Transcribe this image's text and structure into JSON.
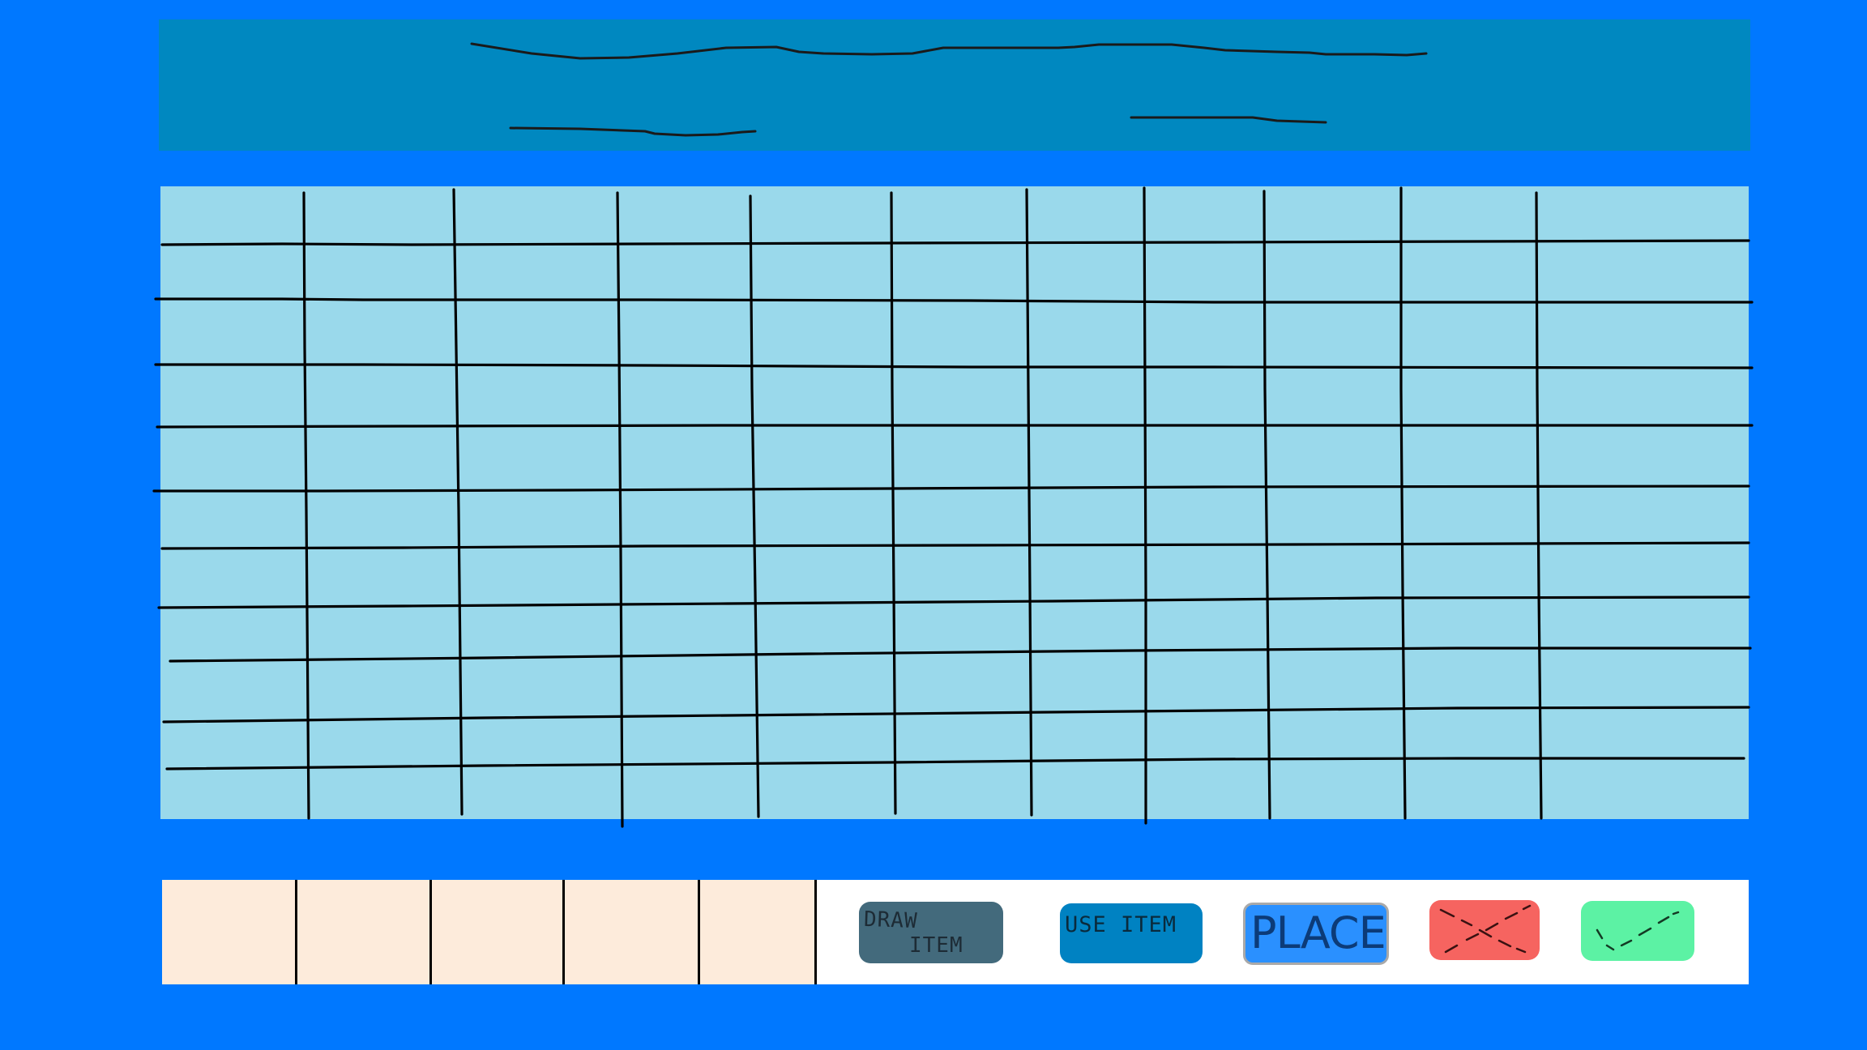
{
  "colors": {
    "background": "#0078ff",
    "header_bar": "#0088c0",
    "board": "#9ad9eb",
    "grid_line": "#000000",
    "sketch_line": "#1a1a1a",
    "bottom_bar": "#ffffff",
    "hand_slot": "#fdebdb",
    "draw_button": "#436a7c",
    "use_button": "#0082c2",
    "place_button": "#2a90ff",
    "cancel_button": "#f66460",
    "confirm_button": "#5cf2a4"
  },
  "board": {
    "columns": 11,
    "rows": 11
  },
  "hand": {
    "slot_count": 5
  },
  "actions": {
    "draw_item_line1": "DRAW",
    "draw_item_line2": "ITEM",
    "use_item": "USE ITEM",
    "place": "PLACE",
    "cancel_icon": "x-icon",
    "confirm_icon": "checkmark-icon"
  }
}
